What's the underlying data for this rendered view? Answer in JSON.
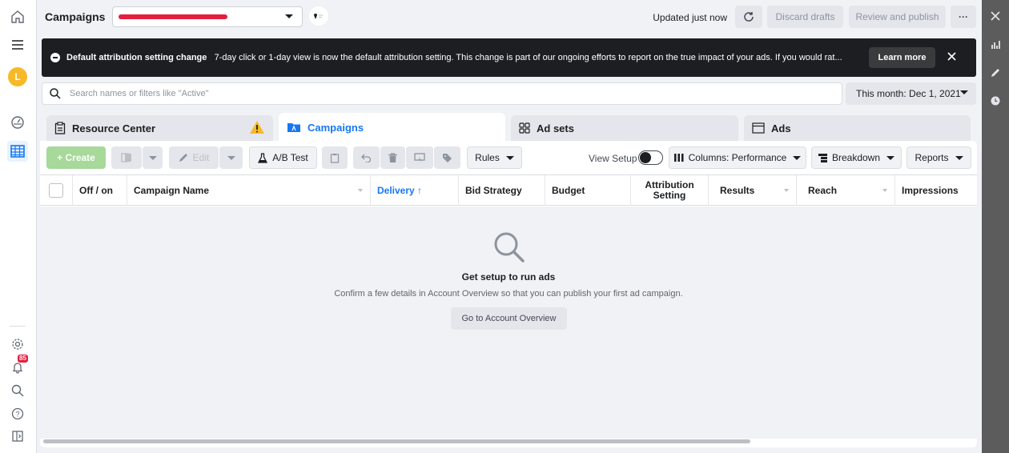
{
  "header": {
    "title": "Campaigns",
    "updated_text": "Updated just now",
    "discard_label": "Discard drafts",
    "review_label": "Review and publish",
    "more_label": "···"
  },
  "user": {
    "avatar_initial": "L"
  },
  "notifications": {
    "badge": "85"
  },
  "banner": {
    "title": "Default attribution setting change",
    "text": "7-day click or 1-day view is now the default attribution setting. This change is part of our ongoing efforts to report on the true impact of your ads. If you would rat...",
    "learn_more_label": "Learn more"
  },
  "search": {
    "placeholder": "Search names or filters like \"Active\""
  },
  "date_range": {
    "label": "This month: Dec 1, 2021"
  },
  "tabs": [
    {
      "label": "Resource Center"
    },
    {
      "label": "Campaigns"
    },
    {
      "label": "Ad sets"
    },
    {
      "label": "Ads"
    }
  ],
  "toolbar": {
    "create_label": "+ Create",
    "edit_label": "Edit",
    "ab_test_label": "A/B Test",
    "rules_label": "Rules",
    "view_setup_label": "View Setup",
    "columns_label": "Columns: Performance",
    "breakdown_label": "Breakdown",
    "reports_label": "Reports"
  },
  "table": {
    "columns": [
      "Off / on",
      "Campaign Name",
      "Delivery ↑",
      "Bid Strategy",
      "Budget",
      "Attribution Setting",
      "Results",
      "Reach",
      "Impressions"
    ]
  },
  "empty_state": {
    "title": "Get setup to run ads",
    "description": "Confirm a few details in Account Overview so that you can publish your first ad campaign.",
    "button_label": "Go to Account Overview"
  },
  "colors": {
    "accent": "#1877f2",
    "banner_bg": "#1c1e21",
    "create_button": "#a6d99a",
    "warning": "#f7b928",
    "redaction": "#e41e3f"
  }
}
